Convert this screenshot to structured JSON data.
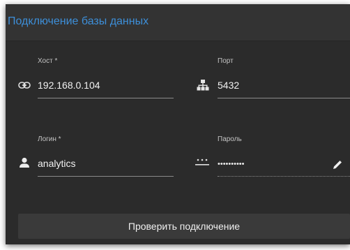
{
  "dialog": {
    "title": "Подключение базы данных"
  },
  "host": {
    "label": "Хост *",
    "value": "192.168.0.104",
    "icon": "link-icon"
  },
  "port": {
    "label": "Порт",
    "value": "5432",
    "icon": "network-icon"
  },
  "login": {
    "label": "Логин *",
    "value": "analytics",
    "icon": "person-icon"
  },
  "password": {
    "label": "Пароль",
    "value": "••••••••••",
    "icon": "password-icon",
    "edit_icon": "pencil-icon"
  },
  "actions": {
    "check_label": "Проверить подключение"
  },
  "colors": {
    "title": "#3d8fd9",
    "background": "#2b2b2b",
    "header": "#333333",
    "button": "#3a3a3a"
  }
}
